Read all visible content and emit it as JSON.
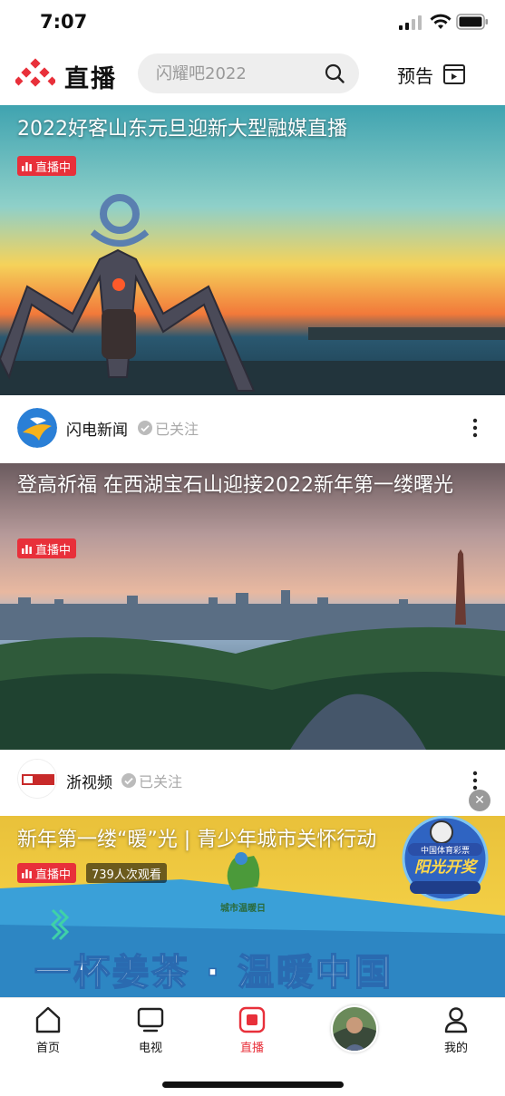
{
  "status": {
    "time": "7:07"
  },
  "header": {
    "title": "直播",
    "search_placeholder": "闪耀吧2022",
    "preview_label": "预告"
  },
  "feed": [
    {
      "title": "2022好客山东元旦迎新大型融媒直播",
      "badge": "直播中",
      "source": "闪电新闻",
      "followed": "已关注"
    },
    {
      "title": "登高祈福 在西湖宝石山迎接2022新年第一缕曙光",
      "badge": "直播中",
      "source": "浙视频",
      "followed": "已关注"
    },
    {
      "title": "新年第一缕“暖”光 | 青少年城市关怀行动",
      "badge": "直播中",
      "viewers": "739人次观看",
      "banner_text": "一杯姜茶 · 温暖中国",
      "brand": "城市温暖日",
      "lottery": "中国体育彩票",
      "lottery_main": "阳光开奖"
    }
  ],
  "tabbar": {
    "items": [
      {
        "label": "首页"
      },
      {
        "label": "电视"
      },
      {
        "label": "直播"
      },
      {
        "label": "我的"
      }
    ]
  },
  "colors": {
    "accent": "#e8303a"
  }
}
